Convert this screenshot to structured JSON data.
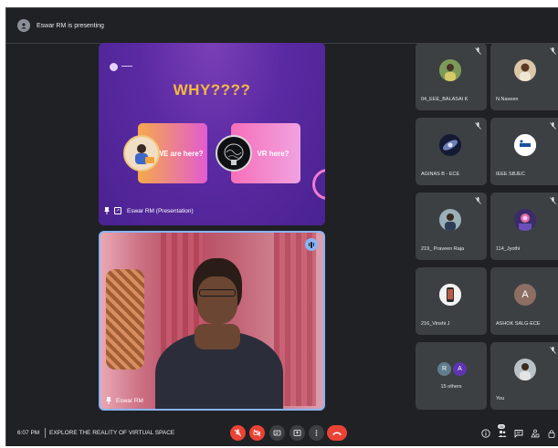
{
  "header": {
    "presenting_text": "Eswar RM is presenting"
  },
  "slide": {
    "title": "WHY????",
    "card_left": "WE are here?",
    "card_right": "VR here?",
    "caption": "Eswar RM (Presentation)"
  },
  "camera": {
    "caption": "Eswar RM"
  },
  "participants": [
    {
      "name": "04_EEE_BALASAI K"
    },
    {
      "name": "N.Naveen"
    },
    {
      "name": "AGINAS B - ECE"
    },
    {
      "name": "IEEE SBJEC"
    },
    {
      "name": "219_ Praveen Raja"
    },
    {
      "name": "114_Jyothi"
    },
    {
      "name": "216_Vinshi J"
    },
    {
      "name": "ASHOK SALG-ECE",
      "initial": "A"
    },
    {
      "name": "15 others",
      "initials": [
        "R",
        "A"
      ]
    },
    {
      "name": "You"
    }
  ],
  "bottombar": {
    "time": "6:07 PM",
    "meeting_title": "EXPLORE THE REALITY OF VIRTUAL SPACE",
    "people_count": "26"
  },
  "controls": [
    {
      "name": "mic-off-icon"
    },
    {
      "name": "camera-off-icon"
    },
    {
      "name": "captions-icon"
    },
    {
      "name": "present-icon"
    },
    {
      "name": "more-icon"
    },
    {
      "name": "end-call-icon"
    }
  ],
  "colors": {
    "background": "#202124",
    "tile": "#3c4043",
    "danger": "#ea4335",
    "slide_purple": "#5b2aa3",
    "slide_title": "#f5b93e",
    "speaking_ring": "#8ab4f8"
  }
}
